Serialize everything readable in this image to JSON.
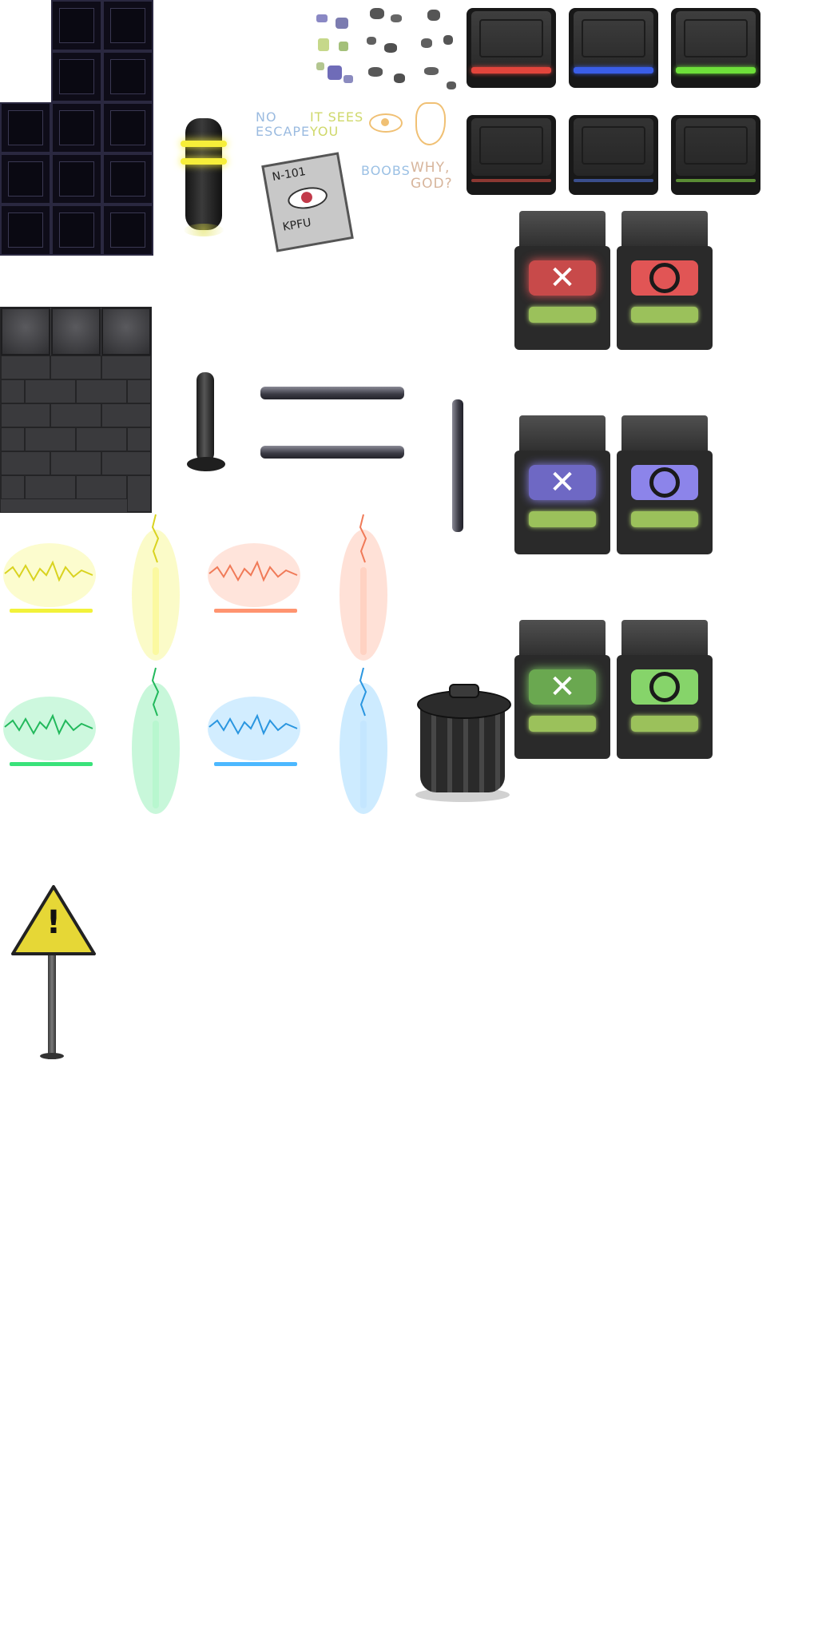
{
  "sprite_sheet": {
    "scribbles": {
      "no_escape": "NO ESCAPE",
      "it_sees_you": "IT SEES YOU",
      "boobs": "BOOBS",
      "why_god": "WHY, GOD?"
    },
    "poster": {
      "top_text": "N-101",
      "bottom_text": "KPFU"
    },
    "button_colors": [
      "#e2453c",
      "#3a5ee8",
      "#6ee03a"
    ],
    "machines": [
      {
        "color": "#e15555",
        "symbol_left": "✕",
        "symbol_right": "○"
      },
      {
        "color": "#8c84ea",
        "symbol_left": "✕",
        "symbol_right": "○"
      },
      {
        "color": "#86d46a",
        "symbol_left": "✕",
        "symbol_right": "○"
      }
    ],
    "glow_colors": [
      "#f2f23a",
      "#ff9470",
      "#39e27a",
      "#4cb8ff"
    ],
    "warning_sign": {
      "glyph": "!"
    }
  }
}
